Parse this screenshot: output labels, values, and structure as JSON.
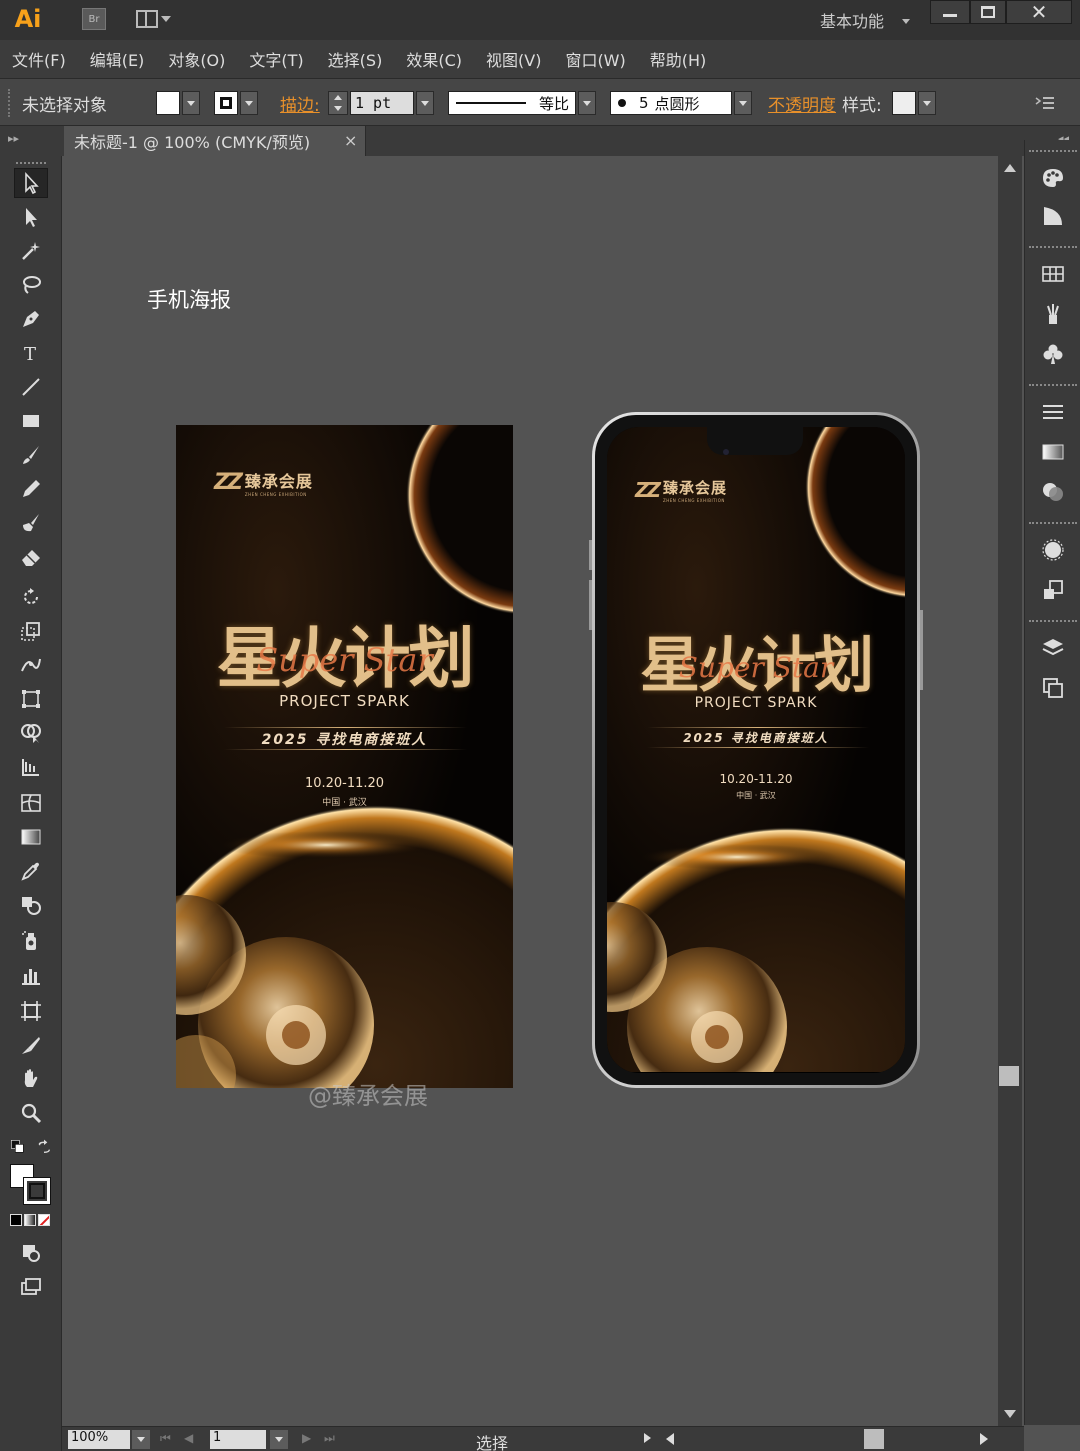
{
  "app": {
    "logo": "Ai",
    "bridge_label": "Br",
    "workspace": "基本功能",
    "close_glyph": "✕"
  },
  "menu": [
    "文件(F)",
    "编辑(E)",
    "对象(O)",
    "文字(T)",
    "选择(S)",
    "效果(C)",
    "视图(V)",
    "窗口(W)",
    "帮助(H)"
  ],
  "control": {
    "no_selection": "未选择对象",
    "stroke_label": "描边",
    "stroke_suffix": ":",
    "stroke_weight": "1 pt",
    "line_profile": "等比",
    "brush_count": "5",
    "brush_type": "点圆形",
    "opacity_label": "不透明度",
    "style_label": "样式:"
  },
  "document": {
    "tab_title": "未标题-1 @ 100% (CMYK/预览)",
    "tab_close": "×"
  },
  "canvas": {
    "artboard_label": "手机海报",
    "watermark": "@臻承会展"
  },
  "poster": {
    "logo_mark": "ZZ",
    "logo_cn": "臻承会展",
    "logo_en": "ZHEN CHENG EXHIBITION",
    "title_cn": "星火计划",
    "title_script": "Super Star",
    "title_en": "PROJECT SPARK",
    "year_tagline": "2025 寻找电商接班人",
    "dates": "10.20-11.20",
    "location": "中国 · 武汉"
  },
  "status": {
    "zoom": "100%",
    "page": "1",
    "tool": "选择"
  },
  "colors": {
    "accent_orange": "#e8902a",
    "gold": "#e2bf8a",
    "panel": "#3a3a3a",
    "canvas": "#535353"
  }
}
